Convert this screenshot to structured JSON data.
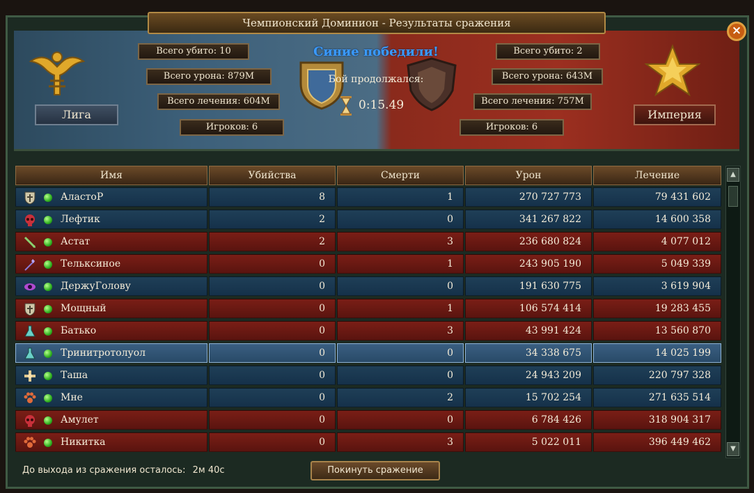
{
  "window": {
    "title": "Чемпионский Доминион - Результаты сражения",
    "close_label": "×"
  },
  "banner": {
    "winner_text": "Синие победили!",
    "duration_label": "Бой продолжался:",
    "duration": "0:15.49",
    "left": {
      "faction": "Лига",
      "kills": "Всего убито: 10",
      "damage": "Всего урона: 879M",
      "healing": "Всего лечения: 604M",
      "players": "Игроков: 6"
    },
    "right": {
      "faction": "Империя",
      "kills": "Всего убито: 2",
      "damage": "Всего урона: 643M",
      "healing": "Всего лечения: 757M",
      "players": "Игроков: 6"
    }
  },
  "table": {
    "headers": {
      "name": "Имя",
      "kills": "Убийства",
      "deaths": "Смерти",
      "damage": "Урон",
      "healing": "Лечение"
    },
    "rows": [
      {
        "name": "АластоР",
        "kills": "8",
        "deaths": "1",
        "damage": "270 727 773",
        "healing": "79 431 602",
        "team": "blue",
        "icon": "shield-icon"
      },
      {
        "name": "Лефтик",
        "kills": "2",
        "deaths": "0",
        "damage": "341 267 822",
        "healing": "14 600 358",
        "team": "blue",
        "icon": "skull-icon"
      },
      {
        "name": "Астат",
        "kills": "2",
        "deaths": "3",
        "damage": "236 680 824",
        "healing": "4 077 012",
        "team": "red",
        "icon": "arrow-icon"
      },
      {
        "name": "Тельксиное",
        "kills": "0",
        "deaths": "1",
        "damage": "243 905 190",
        "healing": "5 049 339",
        "team": "red",
        "icon": "staff-icon"
      },
      {
        "name": "ДержуГолову",
        "kills": "0",
        "deaths": "0",
        "damage": "191 630 775",
        "healing": "3 619 904",
        "team": "blue",
        "icon": "eye-icon"
      },
      {
        "name": "Мощный",
        "kills": "0",
        "deaths": "1",
        "damage": "106 574 414",
        "healing": "19 283 455",
        "team": "red",
        "icon": "shield-icon"
      },
      {
        "name": "Батько",
        "kills": "0",
        "deaths": "3",
        "damage": "43 991 424",
        "healing": "13 560 870",
        "team": "red",
        "icon": "flask-icon"
      },
      {
        "name": "Тринитротолуол",
        "kills": "0",
        "deaths": "0",
        "damage": "34 338 675",
        "healing": "14 025 199",
        "team": "blue",
        "icon": "flask-icon",
        "selected": true
      },
      {
        "name": "Таша",
        "kills": "0",
        "deaths": "0",
        "damage": "24 943 209",
        "healing": "220 797 328",
        "team": "blue",
        "icon": "cross-icon"
      },
      {
        "name": "Мне",
        "kills": "0",
        "deaths": "2",
        "damage": "15 702 254",
        "healing": "271 635 514",
        "team": "blue",
        "icon": "paw-icon"
      },
      {
        "name": "Амулет",
        "kills": "0",
        "deaths": "0",
        "damage": "6 784 426",
        "healing": "318 904 317",
        "team": "red",
        "icon": "skull-icon"
      },
      {
        "name": "Никитка",
        "kills": "0",
        "deaths": "3",
        "damage": "5 022 011",
        "healing": "396 449 462",
        "team": "red",
        "icon": "paw-icon"
      }
    ]
  },
  "footer": {
    "exit_label": "До выхода из сражения осталось:",
    "exit_time": "2м 40с",
    "leave_button": "Покинуть сражение"
  }
}
